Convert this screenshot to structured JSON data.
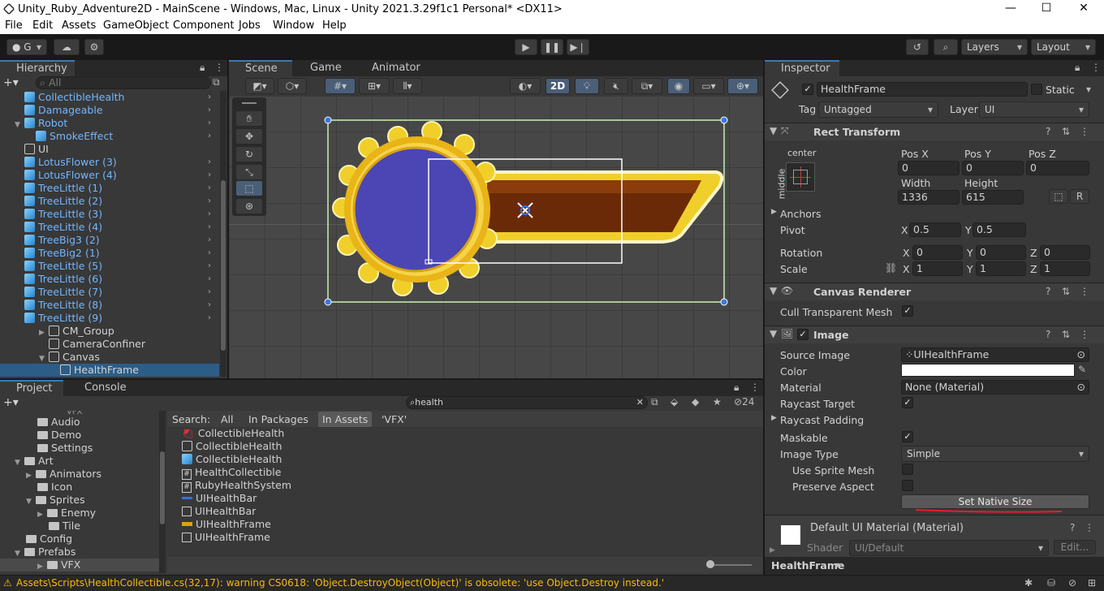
{
  "window": {
    "title": "Unity_Ruby_Adventure2D - MainScene - Windows, Mac, Linux - Unity 2021.3.29f1c1 Personal* <DX11>",
    "minimize": "—",
    "maximize": "☐",
    "close": "✕"
  },
  "menu": [
    "File",
    "Edit",
    "Assets",
    "GameObject",
    "Component",
    "Jobs",
    "Window",
    "Help"
  ],
  "toolbar": {
    "account": "G",
    "layers": "Layers",
    "layout": "Layout"
  },
  "hierarchy": {
    "tab": "Hierarchy",
    "search_placeholder": "All",
    "items": [
      {
        "label": "CollectibleHealth",
        "prefab": true
      },
      {
        "label": "Damageable",
        "prefab": true
      },
      {
        "label": "Robot",
        "prefab": true
      },
      {
        "label": "SmokeEffect",
        "prefab": true
      },
      {
        "label": "UI",
        "prefab": false
      },
      {
        "label": "LotusFlower (3)",
        "prefab": true
      },
      {
        "label": "LotusFlower (4)",
        "prefab": true
      },
      {
        "label": "TreeLittle (1)",
        "prefab": true
      },
      {
        "label": "TreeLittle (2)",
        "prefab": true
      },
      {
        "label": "TreeLittle (3)",
        "prefab": true
      },
      {
        "label": "TreeLittle (4)",
        "prefab": true
      },
      {
        "label": "TreeBig3 (2)",
        "prefab": true
      },
      {
        "label": "TreeBig2 (1)",
        "prefab": true
      },
      {
        "label": "TreeLittle (5)",
        "prefab": true
      },
      {
        "label": "TreeLittle (6)",
        "prefab": true
      },
      {
        "label": "TreeLittle (7)",
        "prefab": true
      },
      {
        "label": "TreeLittle (8)",
        "prefab": true
      },
      {
        "label": "TreeLittle (9)",
        "prefab": true
      },
      {
        "label": "CM_Group",
        "prefab": false
      },
      {
        "label": "CameraConfiner",
        "prefab": false
      },
      {
        "label": "Canvas",
        "prefab": false
      },
      {
        "label": "HealthFrame",
        "prefab": false
      }
    ]
  },
  "scene": {
    "tabs": [
      "Scene",
      "Game",
      "Animator"
    ],
    "mode_2d": "2D"
  },
  "project": {
    "tabs": [
      "Project",
      "Console"
    ],
    "search_value": "health",
    "count": "24",
    "filter_label": "Search:",
    "filters": [
      "All",
      "In Packages",
      "In Assets",
      "'VFX'"
    ],
    "tree": [
      {
        "label": "VFX"
      },
      {
        "label": "Audio"
      },
      {
        "label": "Demo"
      },
      {
        "label": "Settings"
      },
      {
        "label": "Art"
      },
      {
        "label": "Animators"
      },
      {
        "label": "Icon"
      },
      {
        "label": "Sprites"
      },
      {
        "label": "Enemy"
      },
      {
        "label": "Tile"
      },
      {
        "label": "Config"
      },
      {
        "label": "Prefabs"
      },
      {
        "label": "VFX"
      }
    ],
    "results": [
      {
        "label": "CollectibleHealth",
        "icon": "strawberry-icon"
      },
      {
        "label": "CollectibleHealth",
        "icon": "cube-icon"
      },
      {
        "label": "CollectibleHealth",
        "icon": "prefab-icon"
      },
      {
        "label": "HealthCollectible",
        "icon": "script-icon"
      },
      {
        "label": "RubyHealthSystem",
        "icon": "script-icon"
      },
      {
        "label": "UIHealthBar",
        "icon": "sprite-icon"
      },
      {
        "label": "UIHealthBar",
        "icon": "image-icon"
      },
      {
        "label": "UIHealthFrame",
        "icon": "sprite-icon"
      },
      {
        "label": "UIHealthFrame",
        "icon": "image-icon"
      }
    ]
  },
  "inspector": {
    "tab": "Inspector",
    "name": "HealthFrame",
    "static": "Static",
    "tag_label": "Tag",
    "tag": "Untagged",
    "layer_label": "Layer",
    "layer": "UI",
    "rect": {
      "header": "Rect Transform",
      "anchor_h": "center",
      "anchor_v": "middle",
      "posx_label": "Pos X",
      "posy_label": "Pos Y",
      "posz_label": "Pos Z",
      "posx": "0",
      "posy": "0",
      "posz": "0",
      "width_label": "Width",
      "height_label": "Height",
      "width": "1336",
      "height": "615",
      "r_btn": "R",
      "anchors": "Anchors",
      "pivot": "Pivot",
      "pivot_x": "0.5",
      "pivot_y": "0.5",
      "rotation": "Rotation",
      "rot_x": "0",
      "rot_y": "0",
      "rot_z": "0",
      "scale": "Scale",
      "scale_x": "1",
      "scale_y": "1",
      "scale_z": "1",
      "x": "X",
      "y": "Y",
      "z": "Z"
    },
    "canvas_renderer": {
      "header": "Canvas Renderer",
      "cull": "Cull Transparent Mesh"
    },
    "image": {
      "header": "Image",
      "source_image_label": "Source Image",
      "source_image": "UIHealthFrame",
      "color_label": "Color",
      "material_label": "Material",
      "material": "None (Material)",
      "raycast_target": "Raycast Target",
      "raycast_padding": "Raycast Padding",
      "maskable": "Maskable",
      "image_type_label": "Image Type",
      "image_type": "Simple",
      "use_sprite_mesh": "Use Sprite Mesh",
      "preserve_aspect": "Preserve Aspect",
      "set_native_size": "Set Native Size"
    },
    "material": {
      "name": "Default UI Material (Material)",
      "shader_label": "Shader",
      "shader": "UI/Default",
      "edit": "Edit..."
    },
    "footer": "HealthFrame"
  },
  "status": {
    "message": "Assets\\Scripts\\HealthCollectible.cs(32,17): warning CS0618: 'Object.DestroyObject(Object)' is obsolete: 'use Object.Destroy instead.'"
  },
  "colors": {
    "accent": "#3a79bb",
    "prefab_text": "#73b6ff",
    "warning": "#f4bc02",
    "selection": "#2c5d87",
    "annotation": "#e0202a"
  }
}
